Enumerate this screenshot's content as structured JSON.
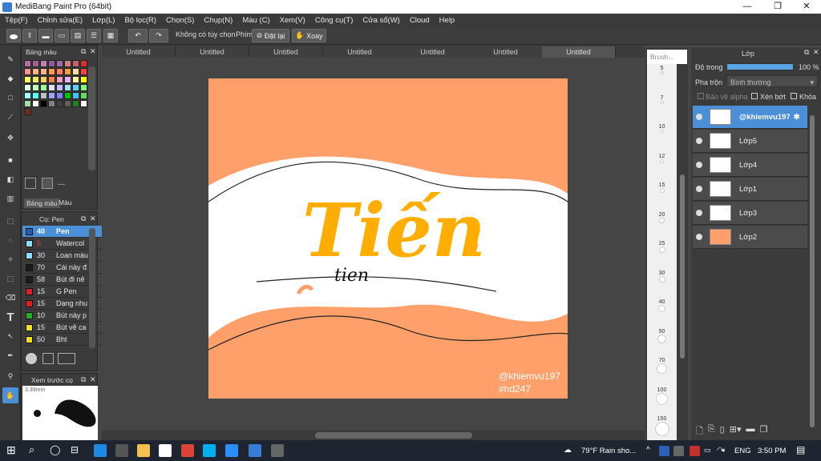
{
  "window": {
    "title": "MediBang Paint Pro (64bit)"
  },
  "menu": [
    "Tệp(F)",
    "Chỉnh sửa(E)",
    "Lớp(L)",
    "Bộ lọc(R)",
    "Chọn(S)",
    "Chụp(N)",
    "Màu (C)",
    "Xem(V)",
    "Công cụ(T)",
    "Cửa sổ(W)",
    "Cloud",
    "Help"
  ],
  "toolbar": {
    "no_option": "Không có tùy chọn",
    "keys_label": "Phím",
    "reset_label": "Đặt lại",
    "rotate_label": "Xoay"
  },
  "doc_tabs": [
    "Untitled",
    "Untitled",
    "Untitled",
    "Untitled",
    "Untitled",
    "Untitled",
    "Untitled"
  ],
  "palette_panel": {
    "title": "Bảng màu",
    "tab_palette": "Bảng màu",
    "tab_color": "Màu",
    "field": "---",
    "colors": [
      "#b36ea0",
      "#a06090",
      "#c080b0",
      "#8f5e8f",
      "#9b6ca8",
      "#d08080",
      "#c06070",
      "#d83030",
      "#ff9090",
      "#ffb080",
      "#ffb090",
      "#ff9a50",
      "#ff7f60",
      "#f0a030",
      "#ffe0a0",
      "#ff4040",
      "#ffff60",
      "#f0f060",
      "#ffd060",
      "#ff8040",
      "#f0a0c0",
      "#e0b0ff",
      "#ffffa0",
      "#ffff00",
      "#e0ffe0",
      "#c0ffc0",
      "#a0ffa0",
      "#e0e0ff",
      "#c0c0ff",
      "#a0e0ff",
      "#60d0ff",
      "#80ff80",
      "#a0ffff",
      "#60ffff",
      "#c0c0c0",
      "#a0a0ff",
      "#8080ff",
      "#00c000",
      "#40c0ff",
      "#60e060",
      "#a0e0a0",
      "#ffffff",
      "#000000",
      "#808080",
      "#404040",
      "#606060",
      "#208020",
      "#ffffff",
      "#6b2f20"
    ]
  },
  "brush_panel": {
    "title": "Cọ: Pen",
    "items": [
      {
        "size": "40",
        "name": "Pen",
        "color": "#2a5fb0"
      },
      {
        "size": "5",
        "name": "Watercol",
        "color": "#8fdcff"
      },
      {
        "size": "30",
        "name": "Loan màu",
        "color": "#8fdcff"
      },
      {
        "size": "70",
        "name": "Cái này đ",
        "color": "#1b1b1b"
      },
      {
        "size": "58",
        "name": "Bút đi nê",
        "color": "#1b1b1b"
      },
      {
        "size": "15",
        "name": "G Pen",
        "color": "#e02020"
      },
      {
        "size": "15",
        "name": "Dạng nhu",
        "color": "#e02020"
      },
      {
        "size": "10",
        "name": "Bút này p",
        "color": "#20b020"
      },
      {
        "size": "15",
        "name": "Bút vẽ ca",
        "color": "#f0e020"
      },
      {
        "size": "50",
        "name": "Bht",
        "color": "#f0e020"
      }
    ]
  },
  "preview_panel": {
    "title": "Xem trước cọ",
    "size": "3.39mm"
  },
  "brush_size_panel": {
    "search": "Brush...",
    "sizes": [
      "5",
      "7",
      "10",
      "12",
      "15",
      "20",
      "25",
      "30",
      "40",
      "50",
      "70",
      "100",
      "150"
    ]
  },
  "layer_panel": {
    "title": "Lớp",
    "opacity_label": "Độ trong",
    "opacity_value": "100 %",
    "blend_label": "Pha trộn",
    "blend_value": "Bình thường",
    "protect_alpha": "Bảo vệ alpha",
    "clip": "Xén bớt",
    "lock": "Khóa",
    "layers": [
      {
        "name": "@khiemvu197",
        "selected": true
      },
      {
        "name": "Lớp5"
      },
      {
        "name": "Lớp4"
      },
      {
        "name": "Lớp1"
      },
      {
        "name": "Lớp3"
      },
      {
        "name": "Lớp2"
      }
    ]
  },
  "artwork": {
    "title": "Tiến",
    "subtitle": "tien",
    "watermark1": "@khiemvu197",
    "watermark2": "#hd247",
    "bg": "#ffa06a",
    "accent": "#ffae00"
  },
  "taskbar": {
    "weather": "79°F  Rain sho...",
    "lang": "ENG",
    "time": "3:50 PM"
  }
}
